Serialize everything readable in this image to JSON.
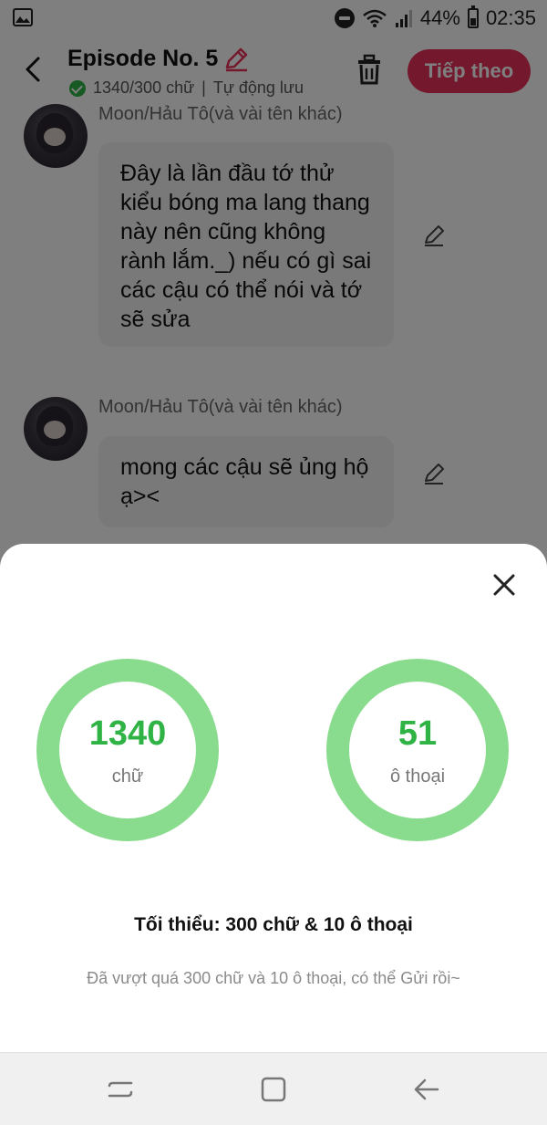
{
  "status_bar": {
    "battery": "44%",
    "time": "02:35"
  },
  "header": {
    "title": "Episode No. 5",
    "word_count": "1340/300 chữ",
    "separator": "|",
    "autosave": "Tự động lưu",
    "next_label": "Tiếp theo"
  },
  "messages": [
    {
      "author": "Moon/Hảu Tô(và vài tên khác)",
      "text": "Đây là lần đầu tớ thử kiểu bóng ma lang thang này nên cũng không rành lắm._) nếu có gì sai các cậu có thể nói và tớ sẽ sửa"
    },
    {
      "author": "Moon/Hảu Tô(và vài tên khác)",
      "text": "mong các cậu sẽ ủng hộ ạ><"
    }
  ],
  "stats_sheet": {
    "words": {
      "value": "1340",
      "unit": "chữ"
    },
    "dialogs": {
      "value": "51",
      "unit": "ô thoại"
    },
    "minimum": "Tối thiểu: 300 chữ & 10 ô thoại",
    "hint": "Đã vượt quá 300 chữ và 10 ô thoại, có thể Gửi rồi~"
  },
  "colors": {
    "accent_pink": "#e8335b",
    "ring_green": "#89db8d",
    "value_green": "#2fb344"
  }
}
